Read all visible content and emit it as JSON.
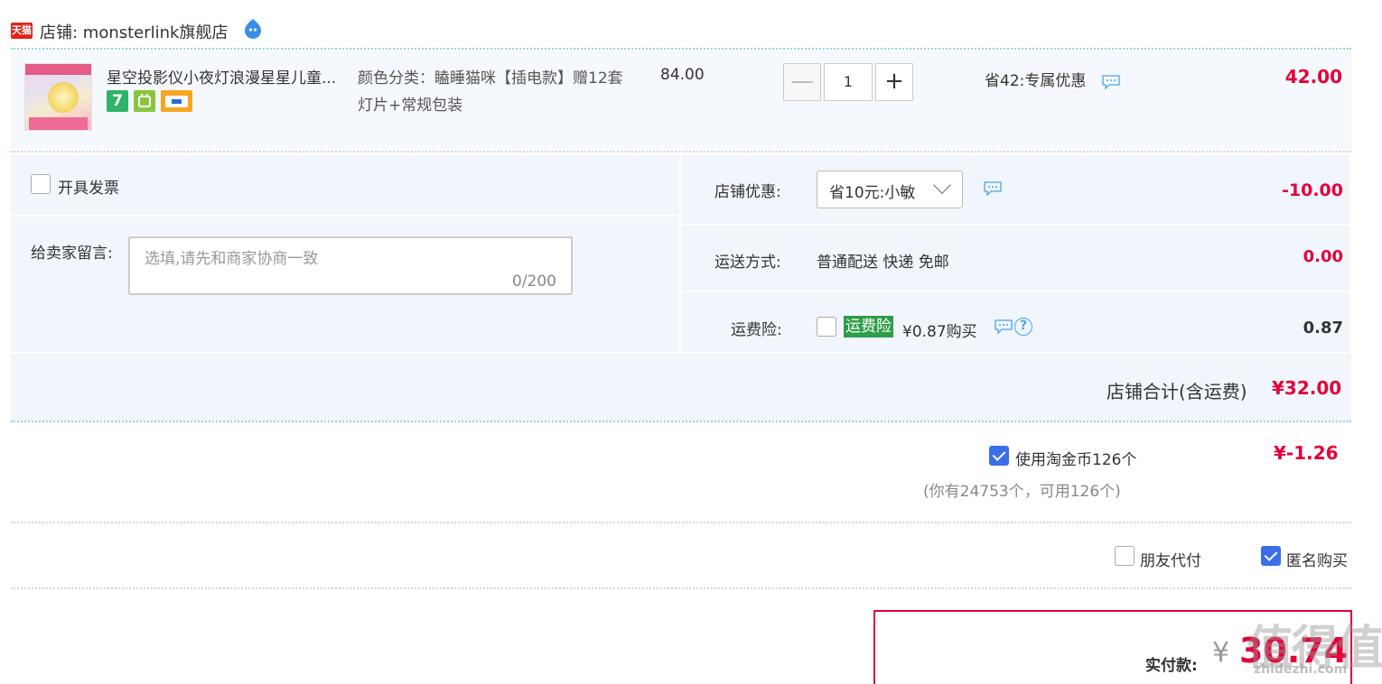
{
  "shop": {
    "tmall_badge": "天猫",
    "name": "店铺: monsterlink旗舰店"
  },
  "item": {
    "title": "星空投影仪小夜灯浪漫星星儿童...",
    "badge_seven": "7",
    "sku": "颜色分类：瞌睡猫咪【插电款】赠12套灯片+常规包装",
    "price": "84.00",
    "quantity": "1",
    "minus_label": "—",
    "plus_label": "+",
    "promo": "省42:专属优惠",
    "subtotal": "42.00"
  },
  "invoice": {
    "label": "开具发票"
  },
  "message": {
    "label": "给卖家留言:",
    "placeholder": "选填,请先和商家协商一致",
    "count": "0/200"
  },
  "shop_discount": {
    "label": "店铺优惠:",
    "selected": "省10元:小敏",
    "amount": "-10.00"
  },
  "shipping": {
    "label": "运送方式:",
    "value": "普通配送 快递 免邮",
    "amount": "0.00"
  },
  "insurance": {
    "label": "运费险:",
    "tag": "运费险",
    "price": "¥0.87购买",
    "help": "?",
    "amount": "0.87"
  },
  "shop_total": {
    "label": "店铺合计(含运费)",
    "amount": "¥32.00"
  },
  "coins": {
    "label": "使用淘金币126个",
    "amount": "¥-1.26",
    "note": "(你有24753个，可用126个)"
  },
  "options": {
    "friend_pay": "朋友代付",
    "anonymous": "匿名购买"
  },
  "payment": {
    "label": "实付款:",
    "currency": "¥",
    "amount": "30.74"
  },
  "watermark": {
    "main": "值得值",
    "sub": "zhidezhi.com"
  },
  "colors": {
    "accent_red": "#e4003a",
    "checkbox_blue": "#3b6fe8",
    "row_bg": "#f1f6fd",
    "insurance_green": "#2e9d47"
  }
}
